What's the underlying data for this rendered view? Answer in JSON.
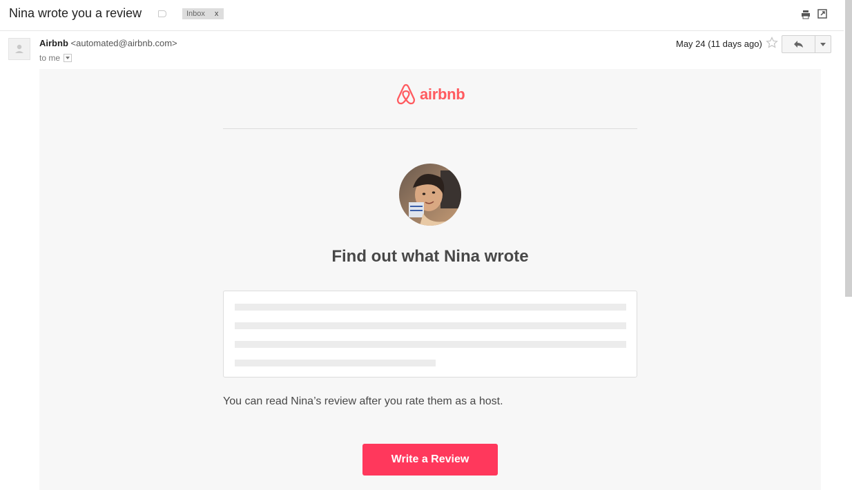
{
  "header": {
    "subject": "Nina wrote you a review",
    "label_chip": "Inbox",
    "label_remove": "x"
  },
  "message": {
    "sender_name": "Airbnb",
    "sender_email": "<automated@airbnb.com>",
    "recipient": "to me",
    "date": "May 24 (11 days ago)"
  },
  "email": {
    "brand": "airbnb",
    "headline": "Find out what Nina wrote",
    "note": "You can read Nina’s review after you rate them as a host.",
    "cta_label": "Write a Review"
  },
  "colors": {
    "brand": "#ff5a5f",
    "cta": "#ff385c",
    "body_bg": "#f7f7f7"
  }
}
